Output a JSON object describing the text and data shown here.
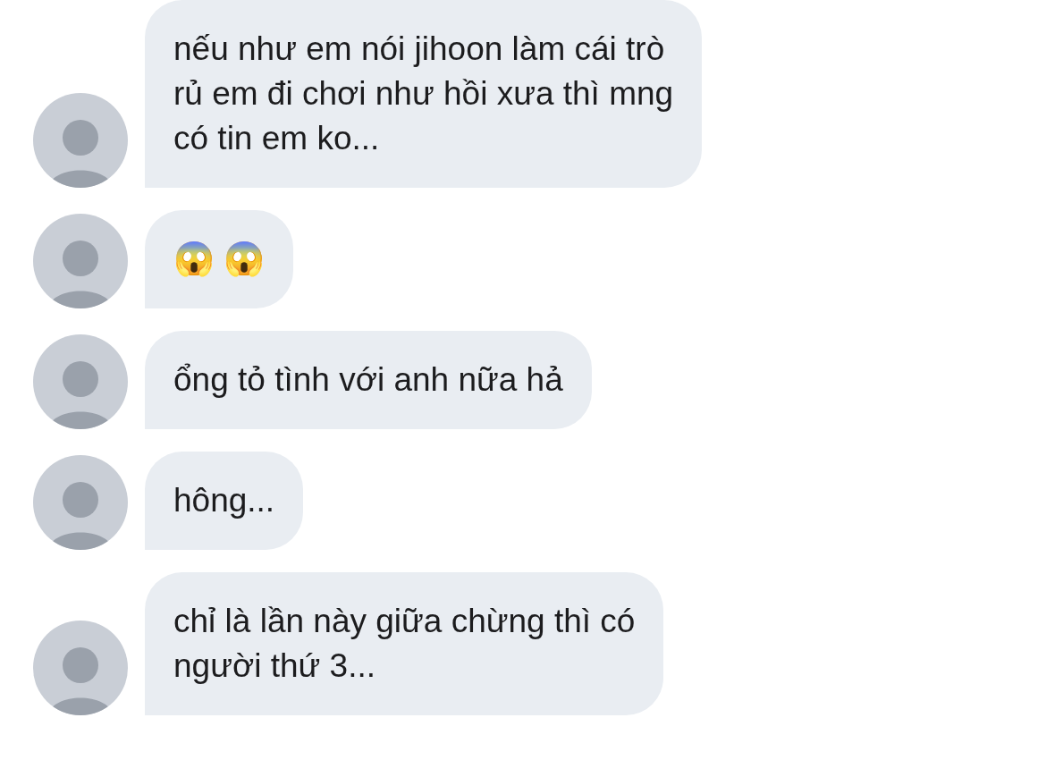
{
  "messages": [
    {
      "text": "nếu như em nói jihoon làm cái trò\nrủ em đi chơi như hồi xưa thì mng\ncó tin em ko..."
    },
    {
      "text": "😱 😱"
    },
    {
      "text": "ổng tỏ tình với anh nữa hả"
    },
    {
      "text": "hông..."
    },
    {
      "text": "chỉ là lần này giữa chừng thì có\nngười thứ 3..."
    }
  ]
}
